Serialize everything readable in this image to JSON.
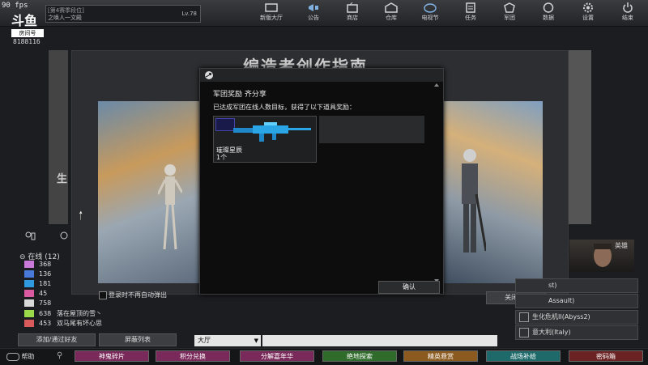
{
  "hud": {
    "fps": "90 fps",
    "room_id": "8188116",
    "platform_logo": "斗鱼",
    "platform_sub": "房间号"
  },
  "player": {
    "line1": "[第4赛季段位]",
    "line2": "之唤人一文殿",
    "level": "Lv.78"
  },
  "nav": [
    {
      "label": "新版大厅",
      "icon": "lobby-icon"
    },
    {
      "label": "公告",
      "icon": "megaphone-icon"
    },
    {
      "label": "商店",
      "icon": "shop-icon"
    },
    {
      "label": "仓库",
      "icon": "warehouse-icon"
    },
    {
      "label": "电视节",
      "icon": "tv-icon"
    },
    {
      "label": "任务",
      "icon": "task-icon"
    },
    {
      "label": "军团",
      "icon": "legion-icon"
    },
    {
      "label": "数据",
      "icon": "data-icon"
    },
    {
      "label": "设置",
      "icon": "settings-icon"
    },
    {
      "label": "结束",
      "icon": "power-icon"
    }
  ],
  "background": {
    "guide_title": "编造者创作指南",
    "left_heading": "生",
    "checkbox_label": "登录时不再自动弹出"
  },
  "friends": {
    "online_label": "在线 (12)",
    "rows": [
      {
        "count": "368",
        "name": ""
      },
      {
        "count": "136",
        "name": ""
      },
      {
        "count": "181",
        "name": ""
      },
      {
        "count": "45",
        "name": ""
      },
      {
        "count": "758",
        "name": ""
      },
      {
        "count": "638",
        "name": "落在屋顶的雪丶"
      },
      {
        "count": "453",
        "name": "双马尾有坏心思"
      }
    ],
    "add_button": "添加/通过好友",
    "block_button": "屏蔽列表"
  },
  "right_panel": {
    "avatar_tag": "英雄",
    "modes": [
      "st)",
      "Assault)",
      "生化危机II(Abyss2)",
      "意大利(Italy)"
    ],
    "close_button": "关闭(B)"
  },
  "chat": {
    "channel": "大厅"
  },
  "bottom": {
    "help": "帮助",
    "buttons": [
      {
        "label": "神鬼碎片",
        "color": "#7a2a5a"
      },
      {
        "label": "积分兑换",
        "color": "#7a2a5a"
      },
      {
        "label": "分解嘉年华",
        "color": "#7a2a5a"
      },
      {
        "label": "绝地探索",
        "color": "#2f6b2a"
      },
      {
        "label": "精英悬赏",
        "color": "#8a5a1e"
      },
      {
        "label": "战场补给",
        "color": "#1e6a6a"
      },
      {
        "label": "密码箱",
        "color": "#6a2222"
      }
    ]
  },
  "modal": {
    "title": "军团奖励 齐分享",
    "message": "已达成军团在线人数目标，获得了以下道具奖励：",
    "item_name": "璀璨星辰",
    "item_qty": "1个",
    "confirm": "确认"
  }
}
